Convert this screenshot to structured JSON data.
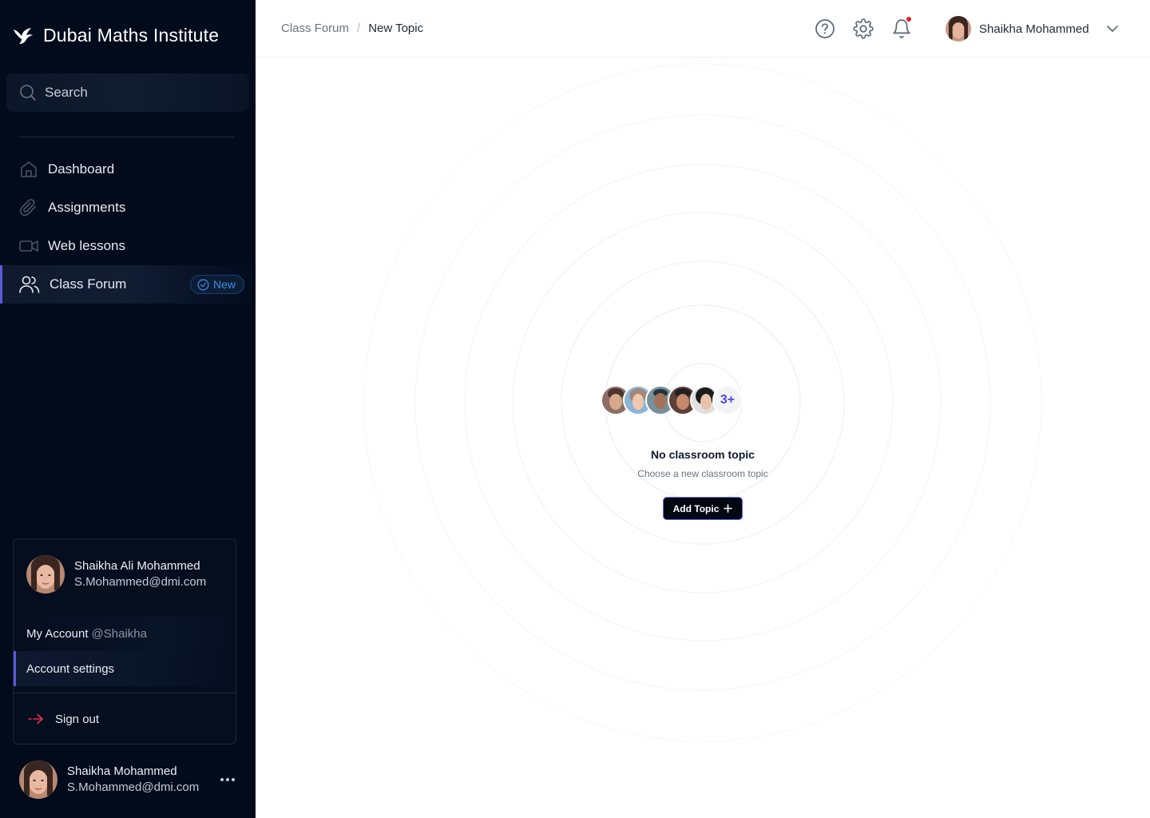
{
  "app": {
    "name": "Dubai Maths Institute"
  },
  "sidebar": {
    "search_placeholder": "Search",
    "items": [
      {
        "label": "Dashboard",
        "icon": "home-icon"
      },
      {
        "label": "Assignments",
        "icon": "paperclip-icon"
      },
      {
        "label": "Web lessons",
        "icon": "video-icon"
      },
      {
        "label": "Class Forum",
        "icon": "users-icon",
        "badge": "New",
        "active": true
      }
    ],
    "account_menu": {
      "user_name": "Shaikha Ali Mohammed",
      "user_email": "S.Mohammed@dmi.com",
      "my_account_label": "My Account",
      "my_account_handle": "@Shaikha",
      "account_settings_label": "Account settings",
      "sign_out_label": "Sign out"
    },
    "bottom_user": {
      "name": "Shaikha Mohammed",
      "email": "S.Mohammed@dmi.com"
    }
  },
  "header": {
    "breadcrumb": [
      "Class Forum",
      "New Topic"
    ],
    "breadcrumb_separator": "/",
    "user_name": "Shaikha Mohammed",
    "has_notification": true
  },
  "empty_state": {
    "avatar_overflow": "3+",
    "title": "No classroom topic",
    "subtitle": "Choose a new classroom topic",
    "button_label": "Add Topic"
  },
  "colors": {
    "sidebar_bg": "#020B1C",
    "accent": "#5b5bd6",
    "badge_blue": "#3f8de0",
    "notification_red": "#e02424",
    "button_bg": "#030712"
  }
}
